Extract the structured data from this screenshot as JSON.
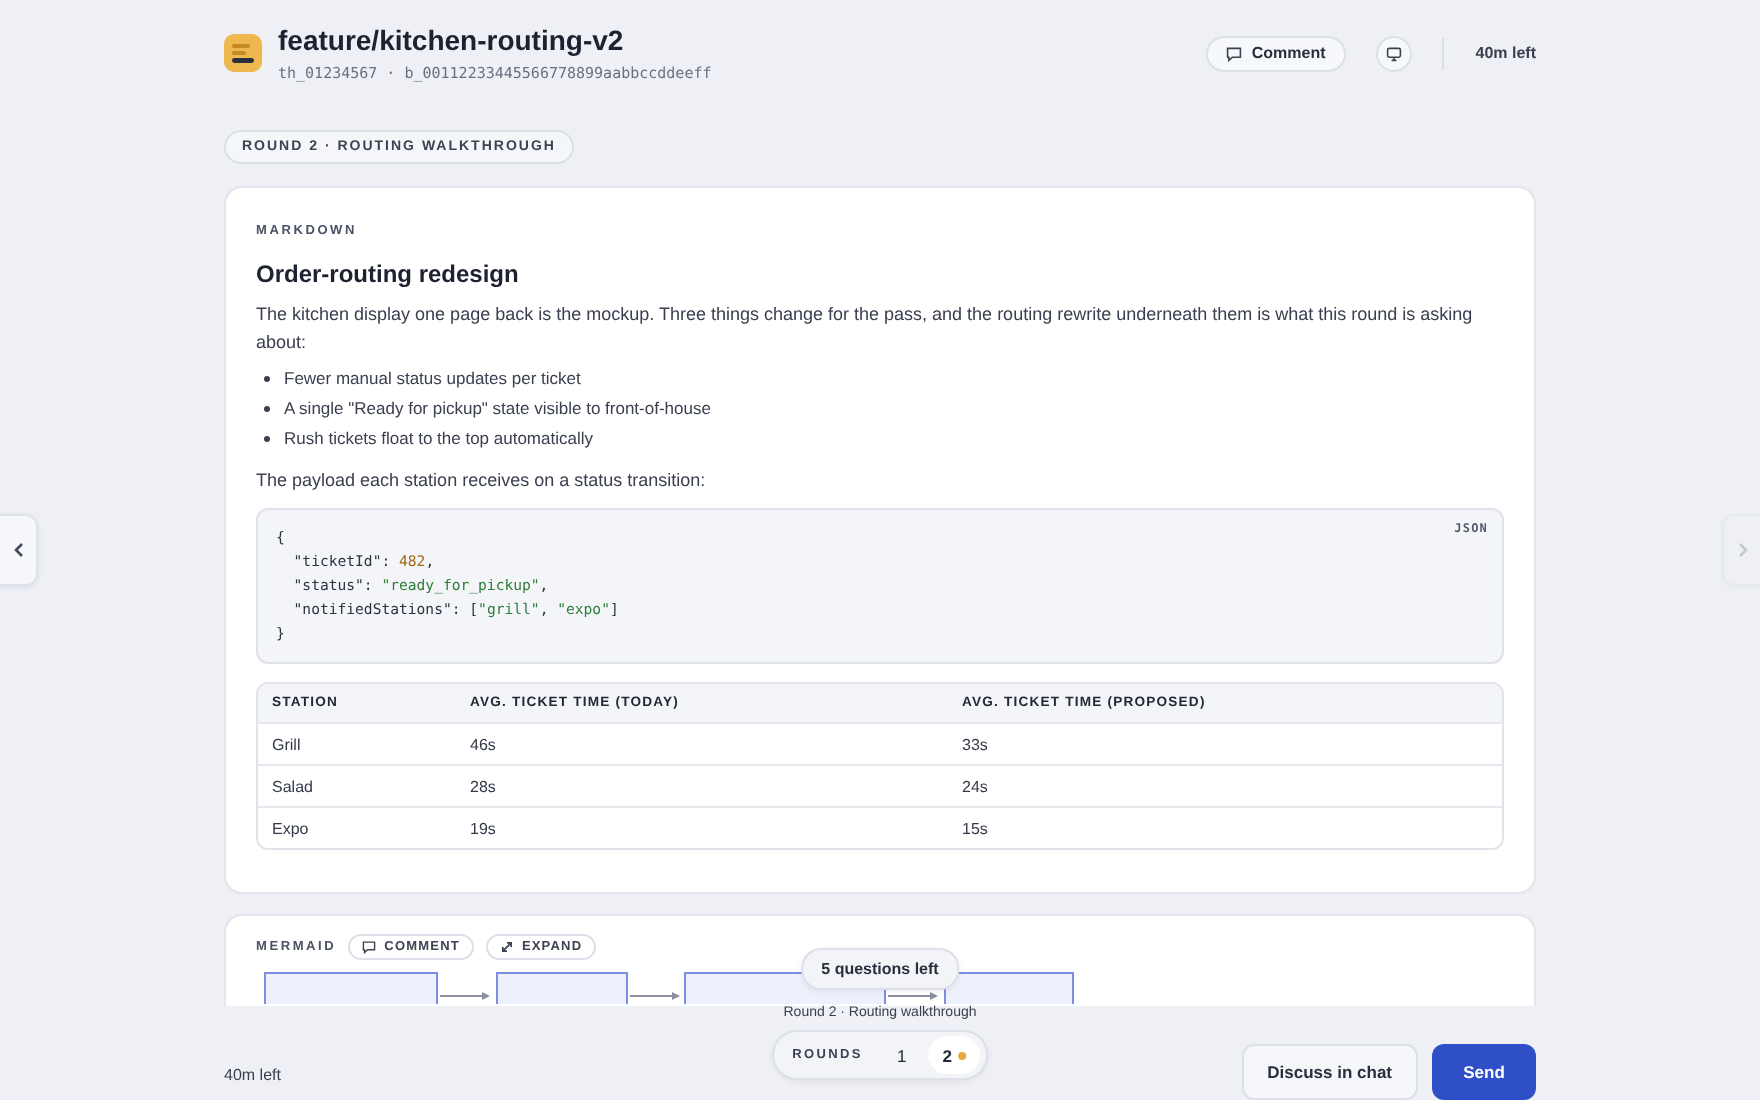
{
  "header": {
    "title": "feature/kitchen-routing-v2",
    "subtitle": "th_01234567 · b_00112233445566778899aabbccddeeff",
    "comment_button": "Comment",
    "time_left": "40m left"
  },
  "round_badge": "ROUND 2 · ROUTING WALKTHROUGH",
  "markdown_card": {
    "label": "MARKDOWN",
    "heading": "Order-routing redesign",
    "intro": "The kitchen display one page back is the mockup. Three things change for the pass, and the routing rewrite underneath them is what this round is asking about:",
    "bullets": [
      "Fewer manual status updates per ticket",
      "A single \"Ready for pickup\" state visible to front-of-house",
      "Rush tickets float to the top automatically"
    ],
    "payload_intro": "The payload each station receives on a status transition:",
    "code": {
      "language": "JSON",
      "lines": [
        [
          {
            "kind": "punct",
            "text": "{"
          }
        ],
        [
          {
            "kind": "key",
            "text": "  \"ticketId\": "
          },
          {
            "kind": "number",
            "text": "482"
          },
          {
            "kind": "punct",
            "text": ","
          }
        ],
        [
          {
            "kind": "key",
            "text": "  \"status\": "
          },
          {
            "kind": "string",
            "text": "\"ready_for_pickup\""
          },
          {
            "kind": "punct",
            "text": ","
          }
        ],
        [
          {
            "kind": "key",
            "text": "  \"notifiedStations\": ["
          },
          {
            "kind": "string",
            "text": "\"grill\""
          },
          {
            "kind": "punct",
            "text": ", "
          },
          {
            "kind": "string",
            "text": "\"expo\""
          },
          {
            "kind": "punct",
            "text": "]"
          }
        ],
        [
          {
            "kind": "punct",
            "text": "}"
          }
        ]
      ]
    },
    "table": {
      "columns": [
        "STATION",
        "AVG. TICKET TIME (TODAY)",
        "AVG. TICKET TIME (PROPOSED)"
      ],
      "rows": [
        [
          "Grill",
          "46s",
          "33s"
        ],
        [
          "Salad",
          "28s",
          "24s"
        ],
        [
          "Expo",
          "19s",
          "15s"
        ]
      ]
    }
  },
  "mermaid_card": {
    "label": "MERMAID",
    "comment_button": "COMMENT",
    "expand_button": "EXPAND"
  },
  "nav": {
    "previous": {
      "disabled": false
    },
    "next": {
      "disabled": true
    }
  },
  "footer": {
    "time_left": "40m left",
    "questions_left": "5 questions left",
    "round_title": "Round 2 · Routing walkthrough",
    "rounds_label": "ROUNDS",
    "rounds": [
      {
        "label": "1",
        "selected": false,
        "current": false
      },
      {
        "label": "2",
        "selected": true,
        "current": true
      }
    ],
    "discuss_button": "Discuss in chat",
    "send_button": "Send"
  }
}
